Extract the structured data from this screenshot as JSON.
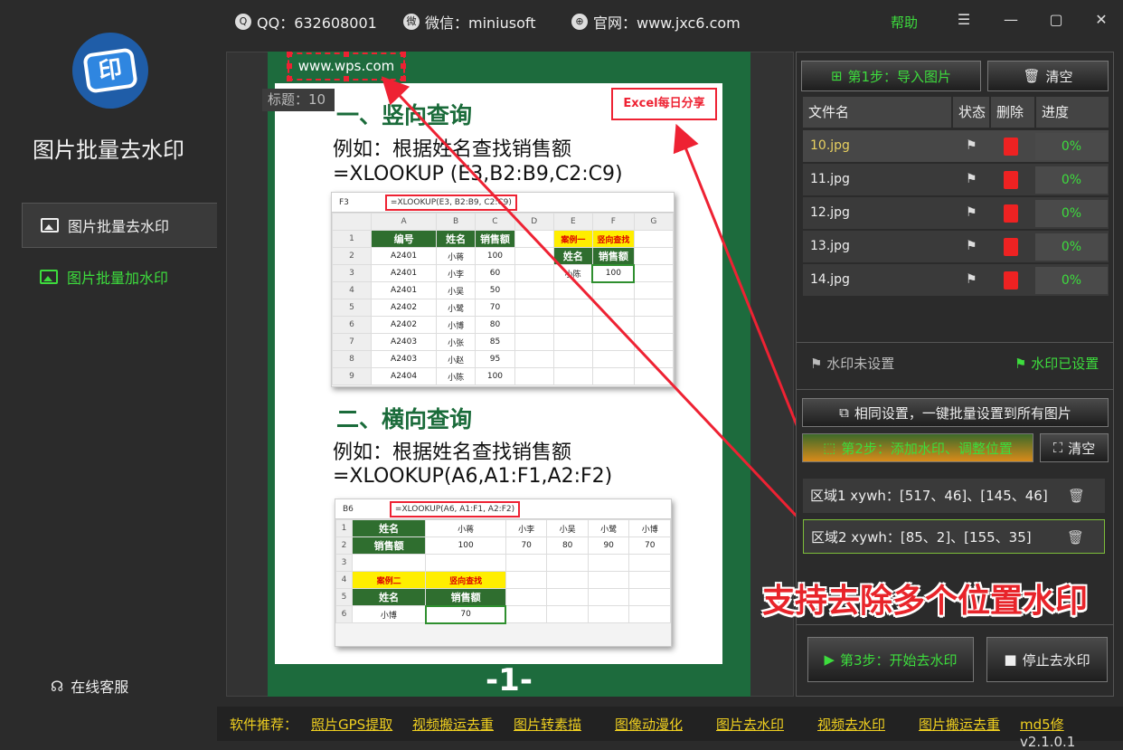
{
  "topbar": {
    "qq": "QQ：632608001",
    "wechat": "微信：miniusoft",
    "website": "官网：www.jxc6.com",
    "help": "帮助",
    "menu_icon": "☰",
    "min_icon": "—",
    "max_icon": "▢",
    "close_icon": "✕"
  },
  "sidebar": {
    "logo_text": "印",
    "app_title": "图片批量去水印",
    "nav": [
      {
        "label": "图片批量去水印"
      },
      {
        "label": "图片批量加水印"
      }
    ],
    "service": "在线客服"
  },
  "canvas": {
    "wps": "www.wps.com",
    "title_badge": "标题：10",
    "excel_badge": "Excel每日分享",
    "section1_title": "一、竖向查询",
    "section1_line1": "例如：根据姓名查找销售额",
    "section1_line2": "=XLOOKUP (E3,B2:B9,C2:C9)",
    "shot1": {
      "cellref": "F3",
      "formula": "=XLOOKUP(E3, B2:B9, C2:C9)",
      "cols": [
        "A",
        "B",
        "C",
        "D",
        "E",
        "F",
        "G"
      ],
      "headers": [
        "编号",
        "姓名",
        "销售额"
      ],
      "rows": [
        [
          "A2401",
          "小蒋",
          "100"
        ],
        [
          "A2401",
          "小李",
          "60"
        ],
        [
          "A2401",
          "小吴",
          "50"
        ],
        [
          "A2402",
          "小鹭",
          "70"
        ],
        [
          "A2402",
          "小博",
          "80"
        ],
        [
          "A2403",
          "小张",
          "85"
        ],
        [
          "A2403",
          "小赵",
          "95"
        ],
        [
          "A2404",
          "小陈",
          "100"
        ]
      ],
      "case_label": "案例一",
      "case_type": "竖向查找",
      "case_h1": "姓名",
      "case_h2": "销售额",
      "case_v1": "小陈",
      "case_v2": "100"
    },
    "section2_title": "二、横向查询",
    "section2_line1": "例如：根据姓名查找销售额",
    "section2_line2": "=XLOOKUP(A6,A1:F1,A2:F2)",
    "shot2": {
      "cellref": "B6",
      "formula": "=XLOOKUP(A6, A1:F1, A2:F2)",
      "row1": [
        "姓名",
        "小蒋",
        "小李",
        "小吴",
        "小鹭",
        "小博"
      ],
      "row2": [
        "销售额",
        "100",
        "70",
        "80",
        "90",
        "70"
      ],
      "case_label": "案例二",
      "case_type": "竖向查找",
      "case_h1": "姓名",
      "case_h2": "销售额",
      "case_v1": "小博",
      "case_v2": "70"
    },
    "page_number": "-1-"
  },
  "right": {
    "step1": "第1步：导入图片",
    "clear1": "清空",
    "cols": {
      "name": "文件名",
      "status": "状态",
      "delete": "删除",
      "progress": "进度"
    },
    "files": [
      {
        "name": "10.jpg",
        "progress": "0%"
      },
      {
        "name": "11.jpg",
        "progress": "0%"
      },
      {
        "name": "12.jpg",
        "progress": "0%"
      },
      {
        "name": "13.jpg",
        "progress": "0%"
      },
      {
        "name": "14.jpg",
        "progress": "0%"
      }
    ],
    "status_unset": "水印未设置",
    "status_set": "水印已设置",
    "same_settings": "相同设置，一键批量设置到所有图片",
    "step2": "第2步：添加水印、调整位置",
    "clear2": "清空",
    "regions": [
      {
        "label": "区域1  xywh：[517、46]、[145、46]"
      },
      {
        "label": "区域2  xywh：[85、2]、[155、35]"
      }
    ],
    "promo": "支持去除多个位置水印",
    "step3": "第3步：开始去水印",
    "stop": "停止去水印"
  },
  "bottom": {
    "rec_label": "软件推荐：",
    "links": [
      "照片GPS提取",
      "视频搬运去重",
      "图片转素描",
      "图像动漫化",
      "图片去水印",
      "视频去水印",
      "图片搬运去重"
    ],
    "md5": "md5修",
    "version": "v2.1.0.1"
  },
  "colors": {
    "accent_green": "#3ddc3d",
    "danger_red": "#e23",
    "page_green": "#1d6b3d",
    "link_yellow": "#f0d020"
  }
}
